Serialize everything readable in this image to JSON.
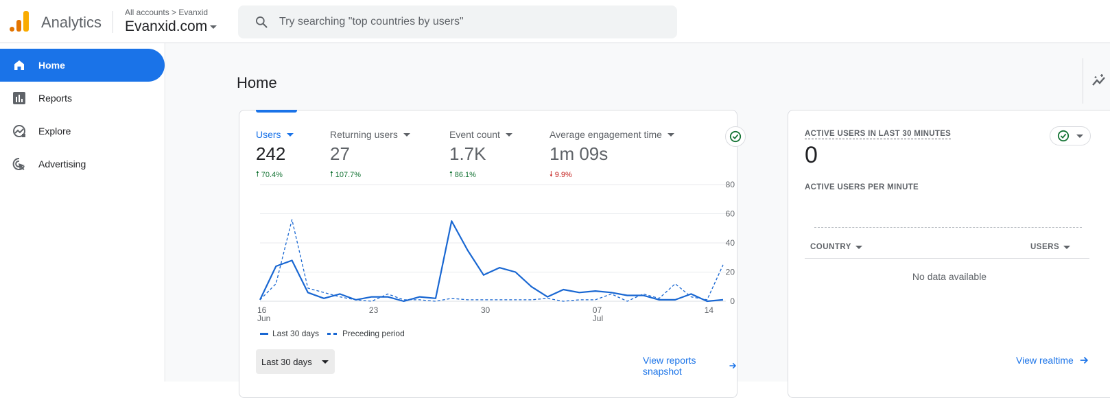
{
  "header": {
    "app_name": "Analytics",
    "breadcrumb": "All accounts > Evanxid",
    "property": "Evanxid.com",
    "search_placeholder": "Try searching \"top countries by users\""
  },
  "sidebar": {
    "items": [
      {
        "label": "Home",
        "icon": "home-icon",
        "active": true
      },
      {
        "label": "Reports",
        "icon": "bar-chart-icon",
        "active": false
      },
      {
        "label": "Explore",
        "icon": "explore-icon",
        "active": false
      },
      {
        "label": "Advertising",
        "icon": "advertising-icon",
        "active": false
      }
    ]
  },
  "main": {
    "title": "Home",
    "metrics": [
      {
        "label": "Users",
        "value": "242",
        "delta": "70.4%",
        "direction": "up"
      },
      {
        "label": "Returning users",
        "value": "27",
        "delta": "107.7%",
        "direction": "up"
      },
      {
        "label": "Event count",
        "value": "1.7K",
        "delta": "86.1%",
        "direction": "up"
      },
      {
        "label": "Average engagement time",
        "value": "1m 09s",
        "delta": "9.9%",
        "direction": "down"
      }
    ],
    "range_button": "Last 30 days",
    "view_link": "View reports snapshot"
  },
  "realtime": {
    "title": "ACTIVE USERS IN LAST 30 MINUTES",
    "value": "0",
    "subtitle": "ACTIVE USERS PER MINUTE",
    "col_country": "COUNTRY",
    "col_users": "USERS",
    "empty": "No data available",
    "view_link": "View realtime"
  },
  "colors": {
    "accent": "#1a73e8",
    "line": "#1967d2",
    "up": "#137333",
    "down": "#c5221f"
  },
  "chart_data": {
    "type": "line",
    "title": "Users",
    "x": [
      "16 Jun",
      "17",
      "18",
      "19",
      "20",
      "21",
      "22",
      "23",
      "24",
      "25",
      "26",
      "27",
      "28",
      "29",
      "30",
      "01 Jul",
      "02",
      "03",
      "04",
      "05",
      "06",
      "07",
      "08",
      "09",
      "10",
      "11",
      "12",
      "13",
      "14",
      "15"
    ],
    "x_tick_labels": [
      {
        "index": 0,
        "label": "16",
        "sub": "Jun"
      },
      {
        "index": 7,
        "label": "23",
        "sub": ""
      },
      {
        "index": 14,
        "label": "30",
        "sub": ""
      },
      {
        "index": 21,
        "label": "07",
        "sub": "Jul"
      },
      {
        "index": 28,
        "label": "14",
        "sub": ""
      }
    ],
    "y_ticks": [
      0,
      20,
      40,
      60,
      80
    ],
    "ylim": [
      0,
      80
    ],
    "grid": true,
    "y_axis_side": "right",
    "legend_position": "bottom-left",
    "series": [
      {
        "name": "Last 30 days",
        "style": "solid",
        "values": [
          1,
          24,
          28,
          6,
          2,
          5,
          1,
          3,
          3,
          0,
          3,
          2,
          55,
          35,
          18,
          23,
          20,
          10,
          3,
          8,
          6,
          7,
          6,
          4,
          4,
          1,
          1,
          5,
          0,
          1
        ]
      },
      {
        "name": "Preceding period",
        "style": "dashed",
        "values": [
          1,
          12,
          56,
          9,
          6,
          3,
          1,
          0,
          5,
          1,
          1,
          0,
          2,
          1,
          1,
          1,
          1,
          1,
          2,
          0,
          1,
          1,
          5,
          0,
          5,
          2,
          12,
          3,
          1,
          25
        ]
      }
    ]
  }
}
